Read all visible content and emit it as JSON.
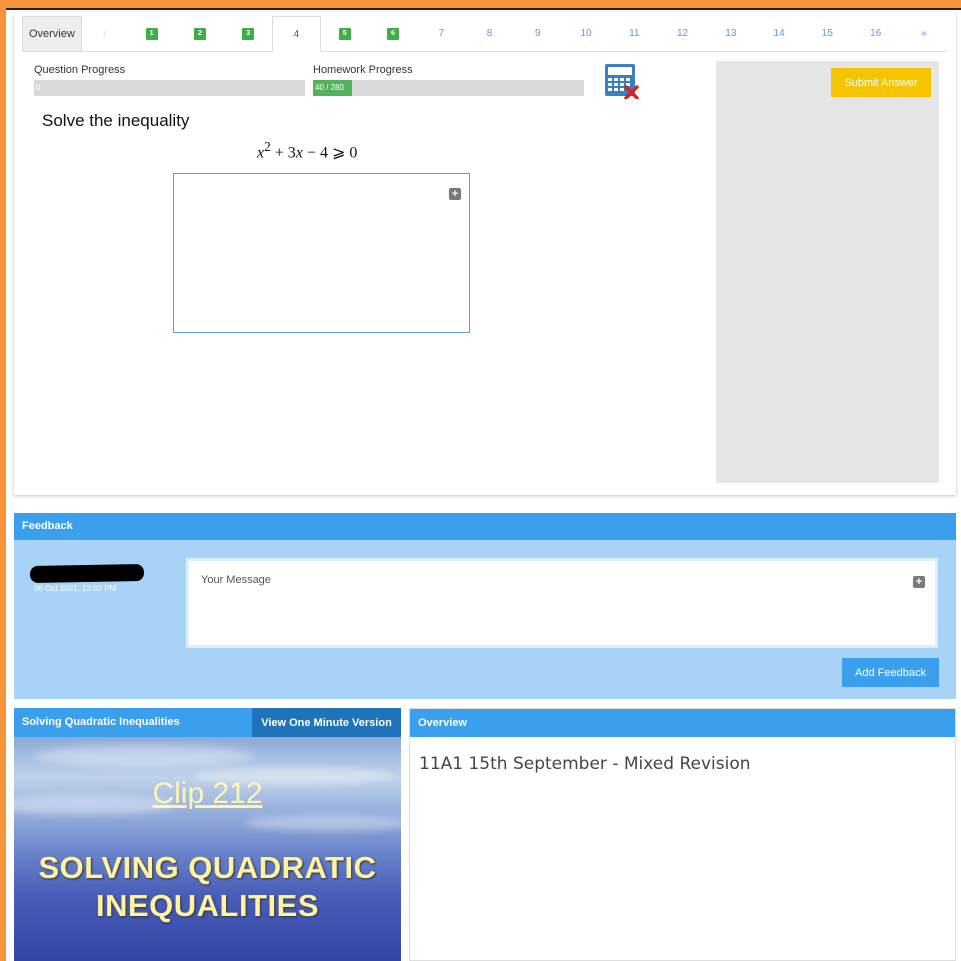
{
  "tabs": {
    "overview": "Overview",
    "prev": "‹",
    "items": [
      {
        "label": "1",
        "state": "done"
      },
      {
        "label": "2",
        "state": "done"
      },
      {
        "label": "3",
        "state": "done"
      },
      {
        "label": "4",
        "state": "active"
      },
      {
        "label": "5",
        "state": "done"
      },
      {
        "label": "6",
        "state": "done"
      },
      {
        "label": "7",
        "state": "todo"
      },
      {
        "label": "8",
        "state": "todo"
      },
      {
        "label": "9",
        "state": "todo"
      },
      {
        "label": "10",
        "state": "todo"
      },
      {
        "label": "11",
        "state": "todo"
      },
      {
        "label": "12",
        "state": "todo"
      },
      {
        "label": "13",
        "state": "todo"
      },
      {
        "label": "14",
        "state": "todo"
      },
      {
        "label": "15",
        "state": "todo"
      },
      {
        "label": "16",
        "state": "todo"
      }
    ],
    "next": "»"
  },
  "progress": {
    "question_label": "Question Progress",
    "question_value": "0",
    "question_fraction": 0,
    "homework_label": "Homework Progress",
    "homework_value": "40 / 280",
    "homework_fraction": 0.143
  },
  "question": {
    "prompt": "Solve the inequality",
    "equation_html": "<i>x</i><sup>2</sup> + 3<i>x</i> − 4 ⩾ 0"
  },
  "submit_label": "Submit Answer",
  "feedback": {
    "header": "Feedback",
    "date": "06 Oct 2021, 12:02 PM",
    "message_placeholder": "Your Message",
    "add_button": "Add Feedback"
  },
  "video": {
    "title": "Solving Quadratic Inequalities",
    "button": "View One Minute Version",
    "clip_number": "Clip 212",
    "clip_title_line1": "SOLVING QUADRATIC",
    "clip_title_line2": "INEQUALITIES"
  },
  "overview": {
    "header": "Overview",
    "text": "11A1 15th September - Mixed Revision"
  },
  "colors": {
    "accent": "#3aa0ee",
    "submit": "#f5c400",
    "done": "#3fae49",
    "frame": "#f7933b"
  },
  "icons": {
    "calculator": "calculator-disabled-icon",
    "expand": "plus-square-icon"
  }
}
